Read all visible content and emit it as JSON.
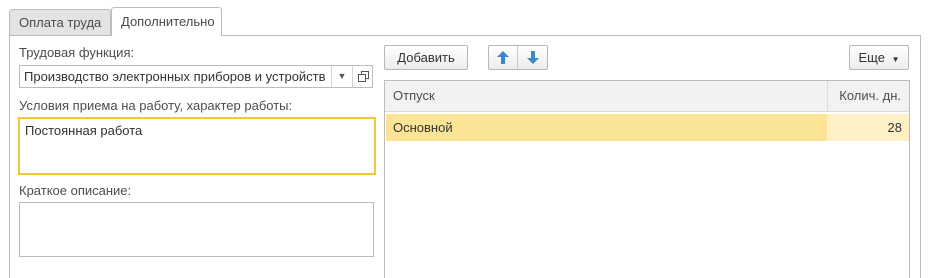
{
  "tabs": [
    {
      "label": "Оплата труда"
    },
    {
      "label": "Дополнительно"
    }
  ],
  "labor_function": {
    "label": "Трудовая функция:",
    "value": "Производство электронных приборов и устройств"
  },
  "employment_conditions": {
    "label": "Условия приема на работу, характер работы:",
    "value": "Постоянная работа"
  },
  "short_description": {
    "label": "Краткое описание:",
    "value": ""
  },
  "toolbar": {
    "add_label": "Добавить",
    "more_label": "Еще"
  },
  "vacation_table": {
    "columns": [
      "Отпуск",
      "Колич. дн."
    ],
    "rows": [
      {
        "name": "Основной",
        "days": "28"
      }
    ]
  },
  "colors": {
    "focus_border": "#f1c932",
    "selected_row": "#fbe495",
    "arrow_blue": "#3a87c9"
  }
}
